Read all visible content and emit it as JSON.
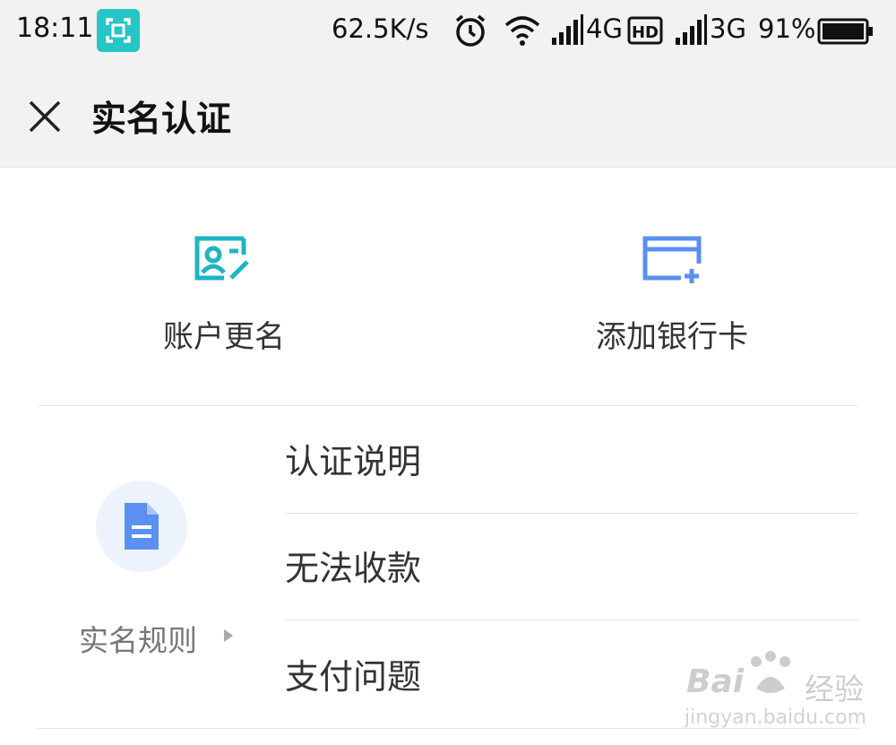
{
  "status_bar": {
    "time": "18:11",
    "speed": "62.5K/s",
    "network_primary": "4G",
    "network_secondary": "3G",
    "battery": "91%",
    "icons": [
      "scan-icon",
      "alarm-icon",
      "wifi-icon",
      "signal-icon",
      "hd-icon",
      "signal-icon",
      "battery-icon"
    ]
  },
  "header": {
    "title": "实名认证",
    "close_icon": "close-icon"
  },
  "quick_actions": [
    {
      "label": "账户更名",
      "icon": "id-card-icon",
      "color": "#1fb5c1"
    },
    {
      "label": "添加银行卡",
      "icon": "add-card-icon",
      "color": "#5b8ff0"
    }
  ],
  "rules": {
    "label": "实名规则",
    "icon": "document-icon",
    "icon_color": "#5b8ff0",
    "icon_bg": "#edf3fd"
  },
  "menu": [
    {
      "label": "认证说明"
    },
    {
      "label": "无法收款"
    },
    {
      "label": "支付问题"
    }
  ],
  "watermark": {
    "brand": "Bai",
    "suffix": "经验",
    "url": "jingyan.baidu.com"
  }
}
